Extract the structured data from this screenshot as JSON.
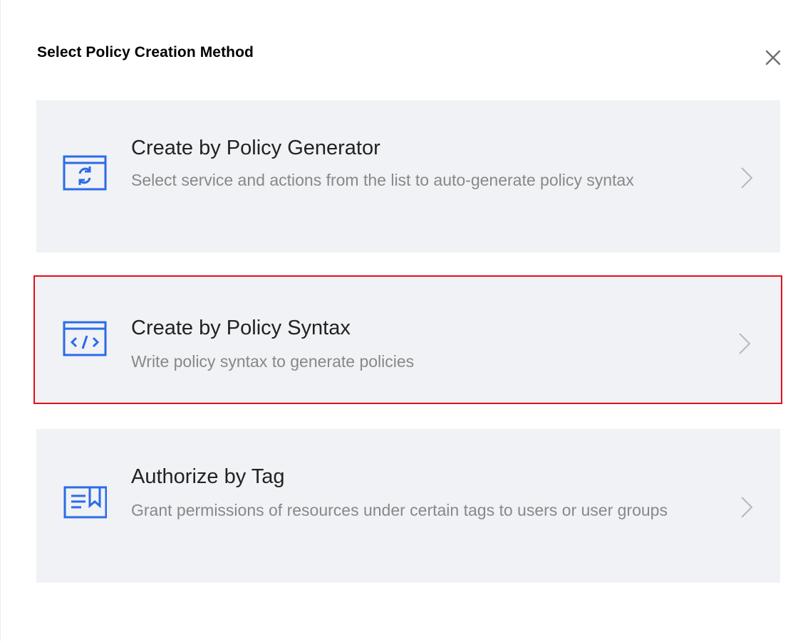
{
  "dialog": {
    "title": "Select Policy Creation Method",
    "close_icon": "close-icon"
  },
  "options": [
    {
      "title": "Create by Policy Generator",
      "description": "Select service and actions from the list to auto-generate policy syntax",
      "icon": "refresh-window-icon",
      "highlighted": false
    },
    {
      "title": "Create by Policy Syntax",
      "description": "Write policy syntax to generate policies",
      "icon": "code-window-icon",
      "highlighted": true
    },
    {
      "title": "Authorize by Tag",
      "description": "Grant permissions of resources under certain tags to users or user groups",
      "icon": "tag-document-icon",
      "highlighted": false
    }
  ],
  "colors": {
    "accent": "#0052d9",
    "card_bg": "#f0f2f5",
    "highlight_border": "#e0101a",
    "title_text": "#222222",
    "desc_text": "#888888",
    "chevron": "#b4b8bf"
  }
}
